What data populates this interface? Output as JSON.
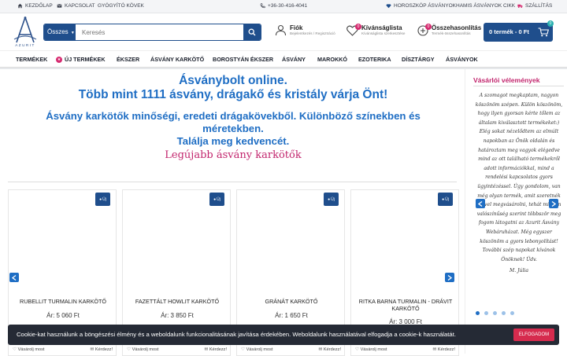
{
  "topbar": {
    "home": "KEZDŐLAP",
    "contact": "KAPCSOLAT",
    "healing": "GYÓGYÍTÓ KÖVEK",
    "phone": "+36-30-416-4041",
    "horoscope": "HOROSZKÓP ÁSVÁNYOK",
    "fake": "HAMIS ÁSVÁNYOK CIKK",
    "shipping": "SZÁLLÍTÁS"
  },
  "logo": {
    "text": "AZURIT"
  },
  "search": {
    "category": "Összes",
    "placeholder": "Keresés"
  },
  "account": {
    "title": "Fiók",
    "subtitle": "Bejelentkezés / Regisztráció"
  },
  "wishlist": {
    "title": "Kívánságlista",
    "subtitle": "Kívánságlista szerkesztése",
    "count": "0"
  },
  "compare": {
    "title": "Összehasonlítás",
    "subtitle": "Termék-összehasonlítás",
    "count": "0"
  },
  "cart": {
    "label": "0 termék - 0 Ft",
    "count": "0"
  },
  "nav": {
    "items": [
      "TERMÉKEK",
      "ÚJ TERMÉKEK",
      "ÉKSZER",
      "ÁSVÁNY KARKÖTŐ",
      "BOROSTYÁN ÉKSZER",
      "ÁSVÁNY",
      "MAROKKÓ",
      "EZOTERIKA",
      "DÍSZTÁRGY",
      "ÁSVÁNYOK"
    ]
  },
  "hero": {
    "line1": "Ásványbolt online.",
    "line2": "Több mint 1111 ásvány, drágakő és kristály várja Önt!",
    "line3": "Ásvány karkötők minőségi, eredeti drágakövekből. Különböző színekben és méretekben.",
    "line4": "Találja meg kedvencét.",
    "subtitle": "Legújabb ásvány karkötők"
  },
  "products": [
    {
      "name": "RUBELLIT TURMALIN KARKÖTŐ",
      "price": "Ár: 5 060 Ft",
      "badge": "Új"
    },
    {
      "name": "FAZETTÁLT HOWLIT KARKÖTŐ",
      "price": "Ár: 3 850 Ft",
      "badge": "Új"
    },
    {
      "name": "GRÁNÁT KARKÖTŐ",
      "price": "Ár: 1 650 Ft",
      "badge": "Új"
    },
    {
      "name": "RITKA BARNA TURMALIN - DRÁVIT KARKÖTŐ",
      "price": "Ár: 3 000 Ft",
      "badge": "Új"
    }
  ],
  "product_actions": {
    "wishlist": "Vásárolj most",
    "ask": "Kérdezz!"
  },
  "sidebar": {
    "title": "Vásárlói vélemények",
    "review": "A szomagot megkaptam, nagyon köszönöm szépen. Külön köszönöm, hogy ilyen gyorsan kérte tőlem az általam kiválasztott termékeket:) Elég sokat nézelődtem az elmúlt napokban az Önök oldalán és határoztam meg vagyok elégedve mind az ott található termékekről adott információkkal, mind a rendelési kapcsolatos gyors ügyintézéssel. Úgy gondolom, van még olyan termék, amit szeretnék idővel megvásárolni, tehát minden valószínűség szerint többször meg fogom látogatni az Azurit Ásvány Webáruházat. Még egyszer köszönöm a gyors lebonyolítást! További szép napokat kívánok Önöknek! Üdv.",
    "author": "M. Júlia"
  },
  "cookie": {
    "text": "Cookie-kat használunk a böngészési élmény és a weboldalunk funkcionalitásának javítása érdekében. Weboldalunk használatával elfogadja a cookie-k használatát.",
    "button": "ELFOGADOM"
  },
  "colors": {
    "primary": "#1f4e8c",
    "accent": "#c2256d",
    "heading": "#1f6ec4",
    "cookie_bg": "#252a35"
  }
}
